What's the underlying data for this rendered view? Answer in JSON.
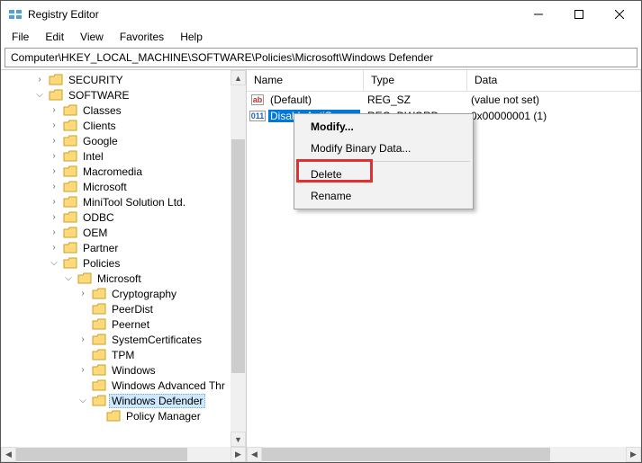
{
  "window": {
    "title": "Registry Editor"
  },
  "menu": {
    "file": "File",
    "edit": "Edit",
    "view": "View",
    "favorites": "Favorites",
    "help": "Help"
  },
  "address": {
    "path": "Computer\\HKEY_LOCAL_MACHINE\\SOFTWARE\\Policies\\Microsoft\\Windows Defender"
  },
  "columns": {
    "name": "Name",
    "type": "Type",
    "data": "Data"
  },
  "rows": [
    {
      "icon": "ab",
      "name": "(Default)",
      "type": "REG_SZ",
      "data": "(value not set)",
      "selected": false
    },
    {
      "icon": "bin",
      "name": "DisableAntiSpy...",
      "type": "REG_DWORD",
      "data": "0x00000001 (1)",
      "selected": true
    }
  ],
  "tree": [
    {
      "indent": 2,
      "exp": ">",
      "label": "SECURITY"
    },
    {
      "indent": 2,
      "exp": "v",
      "label": "SOFTWARE"
    },
    {
      "indent": 3,
      "exp": ">",
      "label": "Classes"
    },
    {
      "indent": 3,
      "exp": ">",
      "label": "Clients"
    },
    {
      "indent": 3,
      "exp": ">",
      "label": "Google"
    },
    {
      "indent": 3,
      "exp": ">",
      "label": "Intel"
    },
    {
      "indent": 3,
      "exp": ">",
      "label": "Macromedia"
    },
    {
      "indent": 3,
      "exp": ">",
      "label": "Microsoft"
    },
    {
      "indent": 3,
      "exp": ">",
      "label": "MiniTool Solution Ltd."
    },
    {
      "indent": 3,
      "exp": ">",
      "label": "ODBC"
    },
    {
      "indent": 3,
      "exp": ">",
      "label": "OEM"
    },
    {
      "indent": 3,
      "exp": ">",
      "label": "Partner"
    },
    {
      "indent": 3,
      "exp": "v",
      "label": "Policies"
    },
    {
      "indent": 4,
      "exp": "v",
      "label": "Microsoft"
    },
    {
      "indent": 5,
      "exp": ">",
      "label": "Cryptography"
    },
    {
      "indent": 5,
      "exp": "",
      "label": "PeerDist"
    },
    {
      "indent": 5,
      "exp": "",
      "label": "Peernet"
    },
    {
      "indent": 5,
      "exp": ">",
      "label": "SystemCertificates"
    },
    {
      "indent": 5,
      "exp": "",
      "label": "TPM"
    },
    {
      "indent": 5,
      "exp": ">",
      "label": "Windows"
    },
    {
      "indent": 5,
      "exp": "",
      "label": "Windows Advanced Thr"
    },
    {
      "indent": 5,
      "exp": "v",
      "label": "Windows Defender",
      "selected": true
    },
    {
      "indent": 6,
      "exp": "",
      "label": "Policy Manager"
    }
  ],
  "ctx": {
    "modify": "Modify...",
    "modify_binary": "Modify Binary Data...",
    "delete": "Delete",
    "rename": "Rename"
  },
  "icons": {
    "ab": "ab",
    "bin": "011\n110"
  }
}
